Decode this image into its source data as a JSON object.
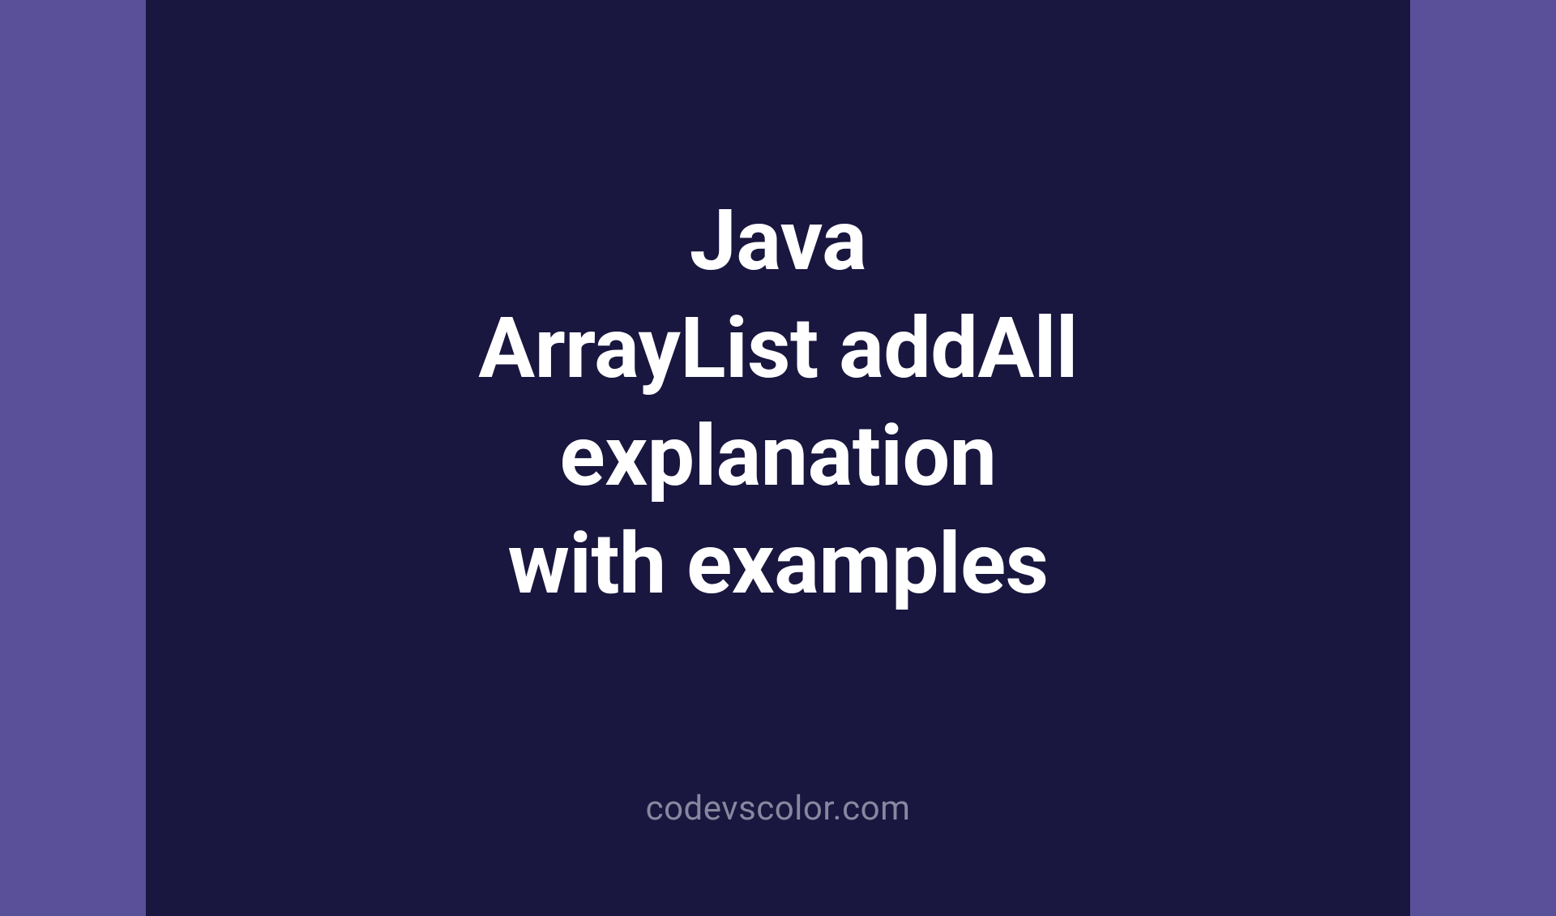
{
  "title": {
    "line1": "Java",
    "line2": "ArrayList addAll",
    "line3": "explanation",
    "line4": "with examples"
  },
  "watermark": "codevscolor.com",
  "colors": {
    "background": "#5a4f99",
    "blob": "#19163f",
    "text": "#ffffff",
    "watermark": "#88879f"
  }
}
